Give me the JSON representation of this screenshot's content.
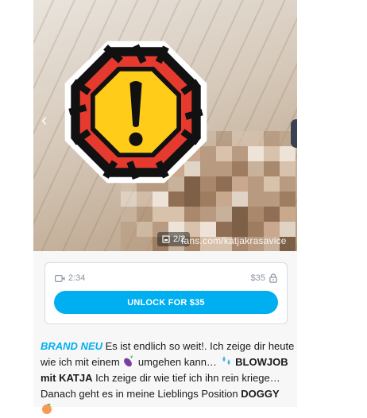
{
  "media": {
    "counter": "2/2",
    "watermark": "fans.com/katjakrasavice",
    "prev_arrow": "‹"
  },
  "unlock": {
    "duration": "2:34",
    "price": "$35",
    "button_label": "UNLOCK FOR $35"
  },
  "description": {
    "tag": "BRAND NEU",
    "part1": " Es ist endlich so weit!. Ich zeige dir heute wie ich mit einem ",
    "part2": " umgehen kann… ",
    "bold1": "BLOWJOB mit KATJA",
    "part3": " Ich zeige dir wie tief ich ihn rein kriege… Danach geht es in meine Lieblings Position ",
    "bold2": "DOGGY",
    "emoji_icons": [
      "eggplant-icon",
      "sweat-droplets-icon",
      "peach-icon"
    ]
  },
  "colors": {
    "accent": "#00aff0",
    "warning_red": "#e63a2e",
    "warning_yellow": "#ffcc1a",
    "warning_black": "#111111"
  }
}
